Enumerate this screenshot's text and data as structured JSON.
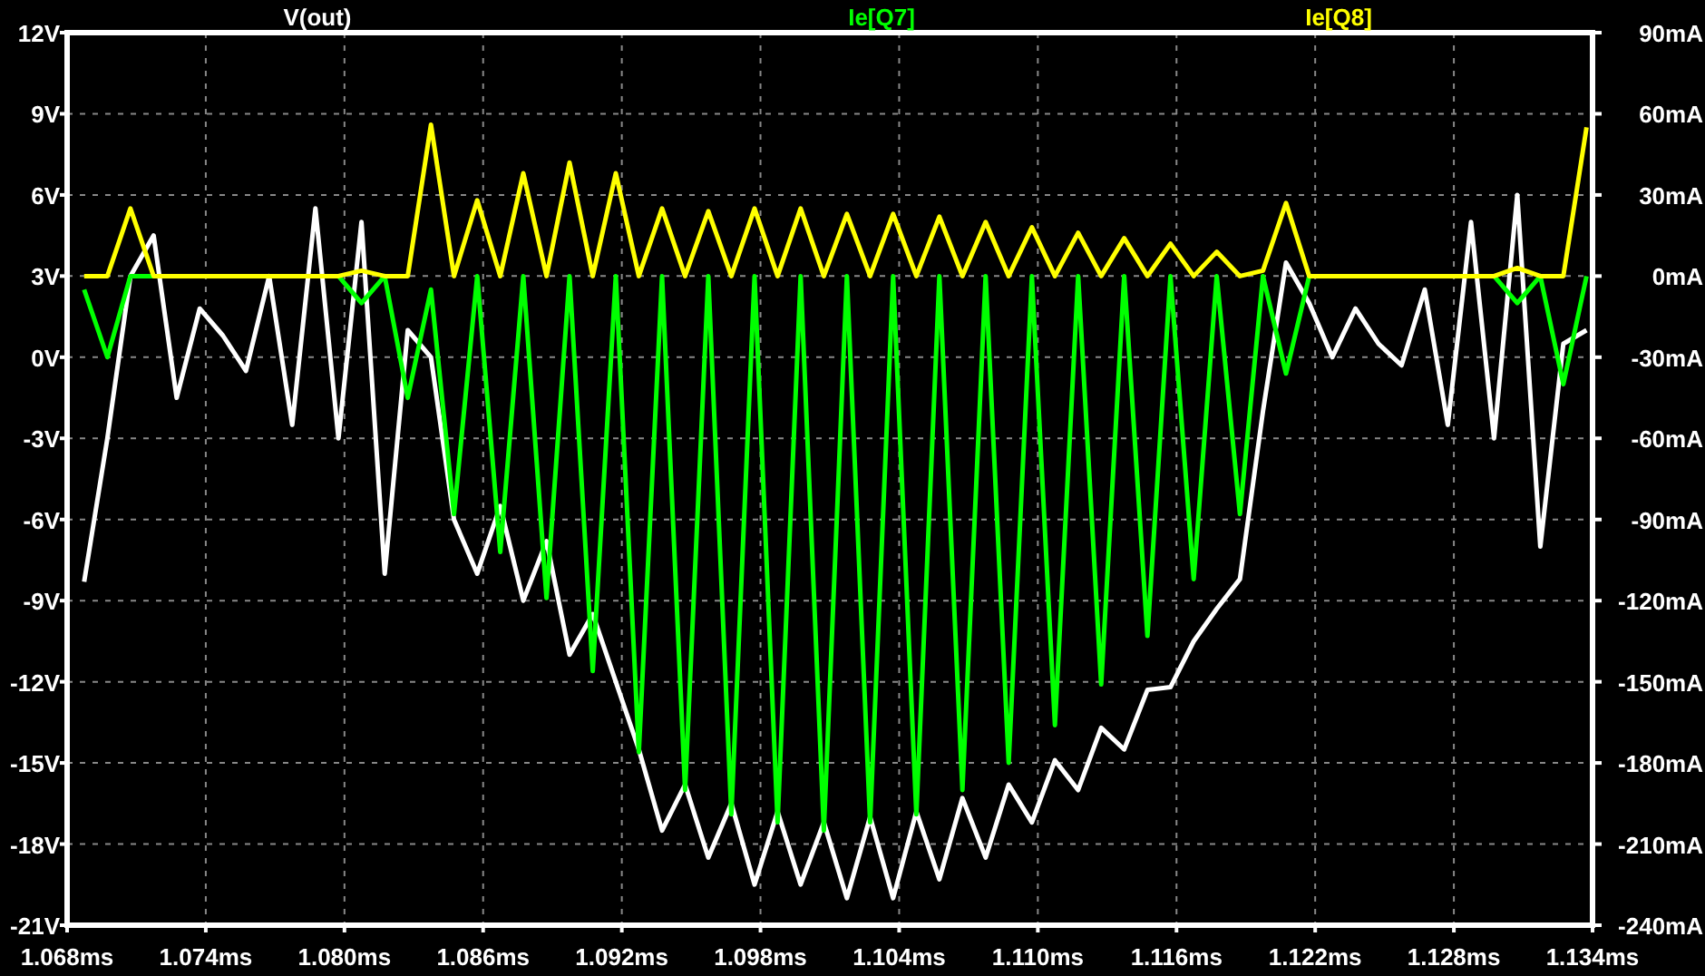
{
  "waveform_viewer": {
    "chart_data": {
      "type": "line",
      "x": [
        1.06874,
        1.06974,
        1.07074,
        1.07174,
        1.07274,
        1.07374,
        1.07474,
        1.07574,
        1.07674,
        1.07774,
        1.07874,
        1.07974,
        1.08074,
        1.08174,
        1.08274,
        1.08374,
        1.08474,
        1.08574,
        1.08674,
        1.08774,
        1.08874,
        1.08974,
        1.09074,
        1.09174,
        1.09274,
        1.09374,
        1.09474,
        1.09574,
        1.09674,
        1.09774,
        1.09874,
        1.09974,
        1.10074,
        1.10174,
        1.10274,
        1.10374,
        1.10474,
        1.10574,
        1.10674,
        1.10774,
        1.10874,
        1.10974,
        1.11074,
        1.11174,
        1.11274,
        1.11374,
        1.11474,
        1.11574,
        1.11674,
        1.11774,
        1.11874,
        1.11974,
        1.12074,
        1.12174,
        1.12274,
        1.12374,
        1.12474,
        1.12574,
        1.12674,
        1.12774,
        1.12874,
        1.12974,
        1.13074,
        1.13174,
        1.13274,
        1.13374
      ],
      "series": [
        {
          "name": "V(out)",
          "color": "#ffffff",
          "values": [
            -8.3,
            -3,
            3,
            4.5,
            -1.5,
            1.8,
            0.8,
            -0.5,
            3,
            -2.5,
            5.5,
            -3,
            5,
            -8,
            1,
            0,
            -6,
            -8,
            -5.5,
            -9,
            -6.8,
            -11,
            -9.5,
            -12,
            -14.5,
            -17.5,
            -15.8,
            -18.5,
            -16.5,
            -19.5,
            -16.8,
            -19.5,
            -17.2,
            -20,
            -17,
            -20,
            -16.8,
            -19.3,
            -16.3,
            -18.5,
            -15.8,
            -17.2,
            -14.9,
            -16,
            -13.7,
            -14.5,
            -12.3,
            -12.2,
            -10.5,
            -9.3,
            -8.2,
            -2,
            3.5,
            2,
            0,
            1.8,
            0.5,
            -0.3,
            2.5,
            -2.5,
            5,
            -3,
            6,
            -7,
            0.5,
            1
          ]
        },
        {
          "name": "Ie[Q7]",
          "color": "#00ff00",
          "axis": "y2",
          "values": [
            -5,
            -30,
            0,
            0,
            0,
            0,
            0,
            0,
            0,
            0,
            0,
            0,
            -10,
            0,
            -45,
            -5,
            -88,
            0,
            -102,
            0,
            -119,
            0,
            -146,
            0,
            -176,
            0,
            -190,
            0,
            -199,
            0,
            -202,
            0,
            -205,
            0,
            -202,
            0,
            -199,
            0,
            -190,
            0,
            -180,
            0,
            -166,
            0,
            -151,
            0,
            -133,
            0,
            -112,
            0,
            -88,
            0,
            -36,
            0,
            0,
            0,
            0,
            0,
            0,
            0,
            0,
            0,
            -10,
            0,
            -40,
            0
          ]
        },
        {
          "name": "Ie[Q8]",
          "color": "#ffff00",
          "axis": "y2",
          "values": [
            0,
            0,
            25,
            0,
            0,
            0,
            0,
            0,
            0,
            0,
            0,
            0,
            2,
            0,
            0,
            56,
            0,
            28,
            0,
            38,
            0,
            42,
            0,
            38,
            0,
            25,
            0,
            24,
            0,
            25,
            0,
            25,
            0,
            23,
            0,
            23,
            0,
            22,
            0,
            20,
            0,
            18,
            0,
            16,
            0,
            14,
            0,
            12,
            0,
            9,
            0,
            2,
            27,
            0,
            0,
            0,
            0,
            0,
            0,
            0,
            0,
            0,
            3,
            0,
            0,
            55
          ]
        }
      ],
      "grid": true,
      "xlim": [
        1.068,
        1.134
      ],
      "xticks": [
        {
          "value": 1.068,
          "label": "1.068ms"
        },
        {
          "value": 1.074,
          "label": "1.074ms"
        },
        {
          "value": 1.08,
          "label": "1.080ms"
        },
        {
          "value": 1.086,
          "label": "1.086ms"
        },
        {
          "value": 1.092,
          "label": "1.092ms"
        },
        {
          "value": 1.098,
          "label": "1.098ms"
        },
        {
          "value": 1.104,
          "label": "1.104ms"
        },
        {
          "value": 1.11,
          "label": "1.110ms"
        },
        {
          "value": 1.116,
          "label": "1.116ms"
        },
        {
          "value": 1.122,
          "label": "1.122ms"
        },
        {
          "value": 1.128,
          "label": "1.128ms"
        },
        {
          "value": 1.134,
          "label": "1.134ms"
        }
      ],
      "ylim": [
        -21,
        12
      ],
      "yticks": [
        {
          "value": 12,
          "label": "12V"
        },
        {
          "value": 9,
          "label": "9V"
        },
        {
          "value": 6,
          "label": "6V"
        },
        {
          "value": 3,
          "label": "3V"
        },
        {
          "value": 0,
          "label": "0V"
        },
        {
          "value": -3,
          "label": "-3V"
        },
        {
          "value": -6,
          "label": "-6V"
        },
        {
          "value": -9,
          "label": "-9V"
        },
        {
          "value": -12,
          "label": "-12V"
        },
        {
          "value": -15,
          "label": "-15V"
        },
        {
          "value": -18,
          "label": "-18V"
        },
        {
          "value": -21,
          "label": "-21V"
        }
      ],
      "y2lim": [
        -240,
        90
      ],
      "y2ticks": [
        {
          "value": 90,
          "label": "90mA"
        },
        {
          "value": 60,
          "label": "60mA"
        },
        {
          "value": 30,
          "label": "30mA"
        },
        {
          "value": 0,
          "label": "0mA"
        },
        {
          "value": -30,
          "label": "-30mA"
        },
        {
          "value": -60,
          "label": "-60mA"
        },
        {
          "value": -90,
          "label": "-90mA"
        },
        {
          "value": -120,
          "label": "-120mA"
        },
        {
          "value": -150,
          "label": "-150mA"
        },
        {
          "value": -180,
          "label": "-180mA"
        },
        {
          "value": -210,
          "label": "-210mA"
        },
        {
          "value": -240,
          "label": "-240mA"
        }
      ]
    }
  }
}
